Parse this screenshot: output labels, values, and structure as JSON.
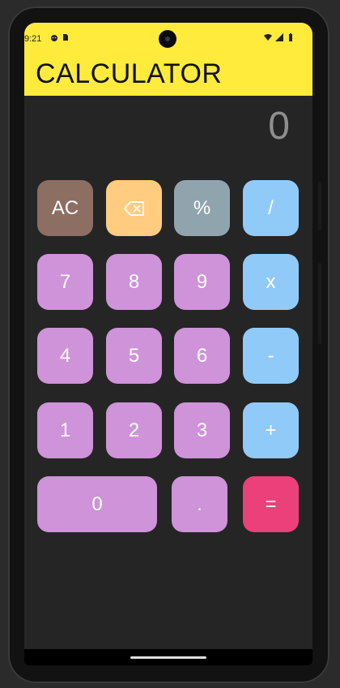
{
  "status_bar": {
    "time": "9:21",
    "left_icons": [
      "android-icon",
      "sim-card-icon"
    ],
    "right_icons": [
      "wifi-icon",
      "signal-icon",
      "battery-icon"
    ]
  },
  "app": {
    "title": "CALCULATOR",
    "title_bar_color": "#ffeb3b"
  },
  "display": {
    "value": "0"
  },
  "keypad": {
    "ac": "AC",
    "backspace_icon": "backspace-icon",
    "percent": "%",
    "divide": "/",
    "seven": "7",
    "eight": "8",
    "nine": "9",
    "multiply": "x",
    "four": "4",
    "five": "5",
    "six": "6",
    "minus": "-",
    "one": "1",
    "two": "2",
    "three": "3",
    "plus": "+",
    "zero": "0",
    "dot": ".",
    "equals": "="
  },
  "colors": {
    "number": "#ce93d8",
    "operator": "#90caf9",
    "clear": "#8d6e63",
    "backspace": "#ffcc80",
    "percent": "#90a4ae",
    "equals": "#ec407a"
  }
}
